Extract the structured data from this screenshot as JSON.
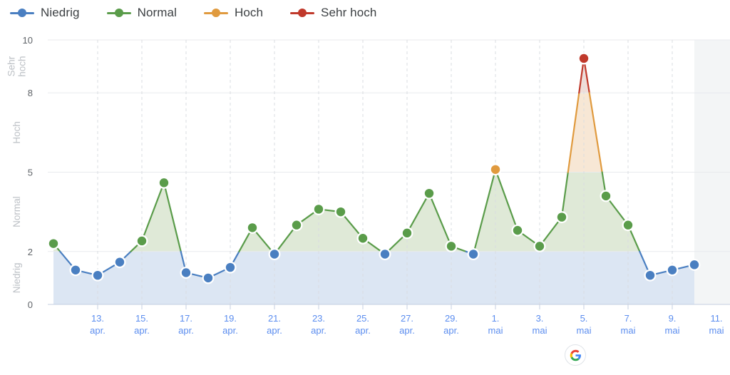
{
  "legend": {
    "items": [
      {
        "label": "Niedrig",
        "color": "#4a7fc1",
        "icon": "legend-line-dot-icon"
      },
      {
        "label": "Normal",
        "color": "#5a9c4a",
        "icon": "legend-line-dot-icon"
      },
      {
        "label": "Hoch",
        "color": "#e09a3e",
        "icon": "legend-line-dot-icon"
      },
      {
        "label": "Sehr hoch",
        "color": "#c0392b",
        "icon": "legend-line-dot-icon"
      }
    ]
  },
  "branding": {
    "logo": "google-g-icon"
  },
  "chart_data": {
    "type": "line",
    "title": "",
    "xlabel": "",
    "ylabel": "",
    "ylim": [
      0,
      10
    ],
    "yticks": [
      0,
      2,
      5,
      8,
      10
    ],
    "grid": true,
    "legend_position": "top-left",
    "band_labels": [
      "Niedrig",
      "Normal",
      "Hoch",
      "Sehr hoch"
    ],
    "bands": [
      {
        "name": "Niedrig",
        "from": 0,
        "to": 2,
        "color": "#4a7fc1",
        "fill": "#dce6f3"
      },
      {
        "name": "Normal",
        "from": 2,
        "to": 5,
        "color": "#5a9c4a",
        "fill": "#dfe9d7"
      },
      {
        "name": "Hoch",
        "from": 5,
        "to": 8,
        "color": "#e09a3e",
        "fill": "#f7e7d5"
      },
      {
        "name": "Sehr hoch",
        "from": 8,
        "to": 10,
        "color": "#c0392b",
        "fill": "#f0ddd8"
      }
    ],
    "xtick_labels": [
      {
        "day": "13.",
        "month": "apr."
      },
      {
        "day": "15.",
        "month": "apr."
      },
      {
        "day": "17.",
        "month": "apr."
      },
      {
        "day": "19.",
        "month": "apr."
      },
      {
        "day": "21.",
        "month": "apr."
      },
      {
        "day": "23.",
        "month": "apr."
      },
      {
        "day": "25.",
        "month": "apr."
      },
      {
        "day": "27.",
        "month": "apr."
      },
      {
        "day": "29.",
        "month": "apr."
      },
      {
        "day": "1.",
        "month": "mai"
      },
      {
        "day": "3.",
        "month": "mai"
      },
      {
        "day": "5.",
        "month": "mai"
      },
      {
        "day": "7.",
        "month": "mai"
      },
      {
        "day": "9.",
        "month": "mai"
      },
      {
        "day": "11.",
        "month": "mai"
      }
    ],
    "x": [
      "11. apr.",
      "12. apr.",
      "13. apr.",
      "14. apr.",
      "15. apr.",
      "16. apr.",
      "17. apr.",
      "18. apr.",
      "19. apr.",
      "20. apr.",
      "21. apr.",
      "22. apr.",
      "23. apr.",
      "24. apr.",
      "25. apr.",
      "26. apr.",
      "27. apr.",
      "28. apr.",
      "29. apr.",
      "30. apr.",
      "1. mai",
      "2. mai",
      "3. mai",
      "4. mai",
      "5. mai",
      "6. mai",
      "7. mai",
      "8. mai",
      "9. mai",
      "10. mai",
      "11. mai"
    ],
    "values": [
      2.3,
      1.3,
      1.1,
      1.6,
      2.4,
      4.6,
      1.2,
      1.0,
      1.4,
      2.9,
      1.9,
      3.0,
      3.6,
      3.5,
      2.5,
      1.9,
      2.7,
      4.2,
      2.2,
      1.9,
      5.1,
      2.8,
      2.2,
      3.3,
      9.3,
      4.1,
      3.0,
      1.1,
      1.3,
      1.5
    ],
    "x_forecast_start": "10. mai",
    "forecast_shading": true
  }
}
